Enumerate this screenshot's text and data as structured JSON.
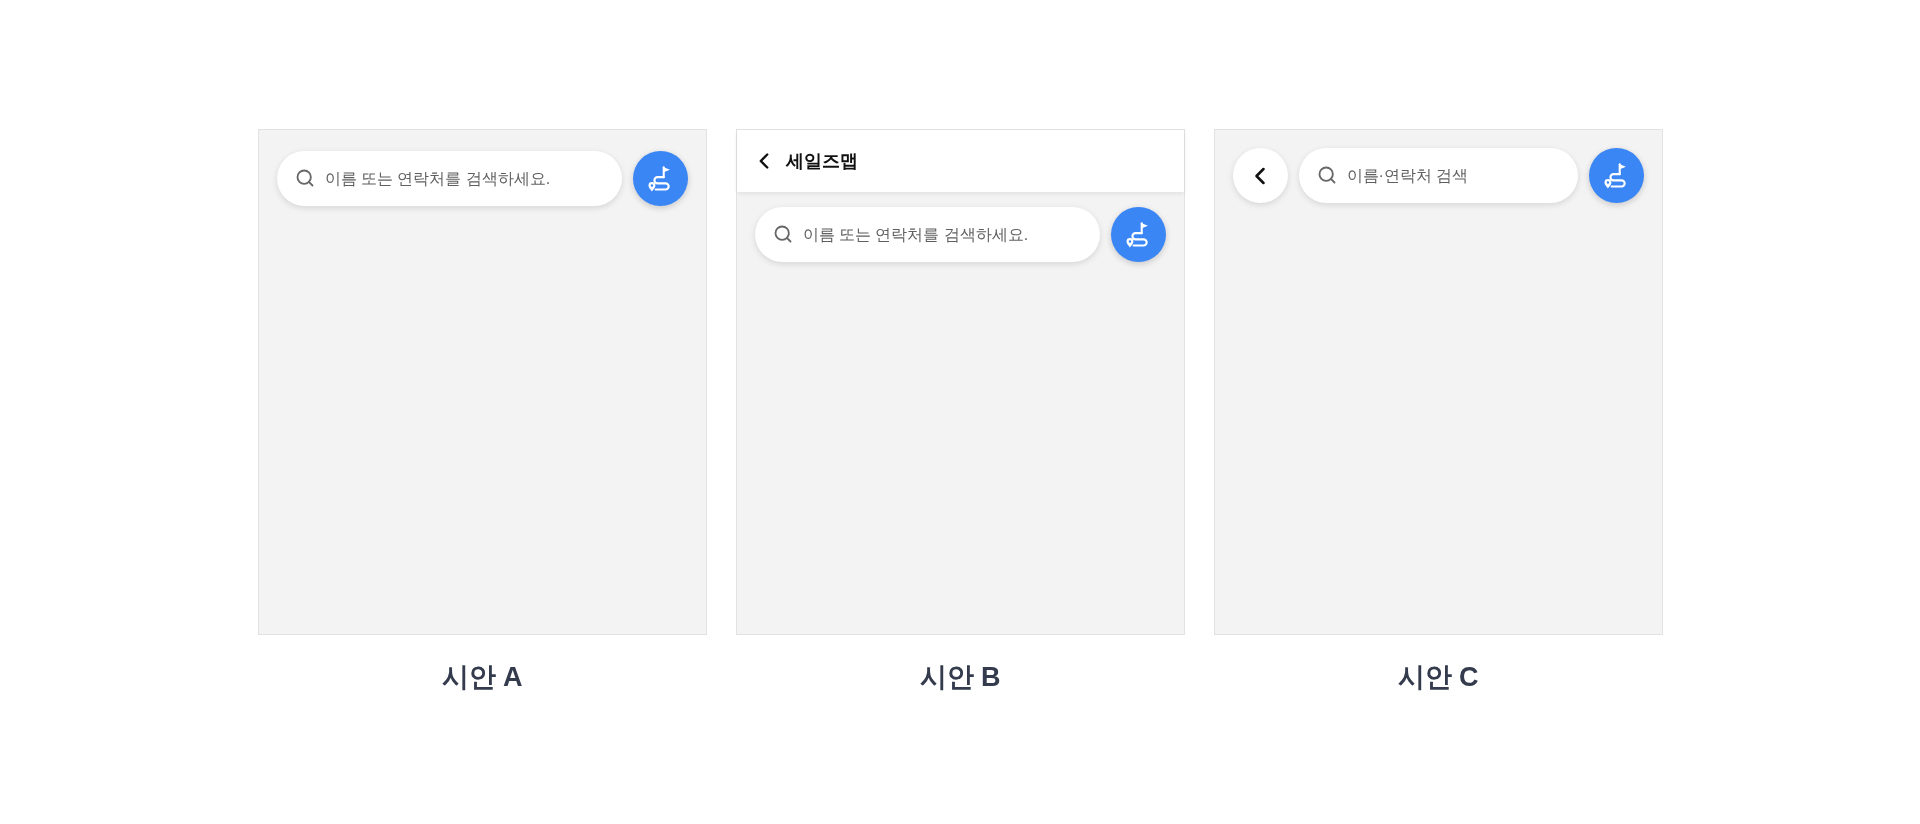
{
  "mockups": [
    {
      "kind": "plain",
      "caption": "시안 A",
      "search": {
        "placeholder": "이름 또는 연락처를 검색하세요."
      }
    },
    {
      "kind": "header",
      "caption": "시안 B",
      "header": {
        "title": "세일즈맵"
      },
      "search": {
        "placeholder": "이름 또는 연락처를 검색하세요."
      }
    },
    {
      "kind": "inline_back",
      "caption": "시안 C",
      "search": {
        "placeholder": "이름·연락처 검색"
      }
    }
  ]
}
